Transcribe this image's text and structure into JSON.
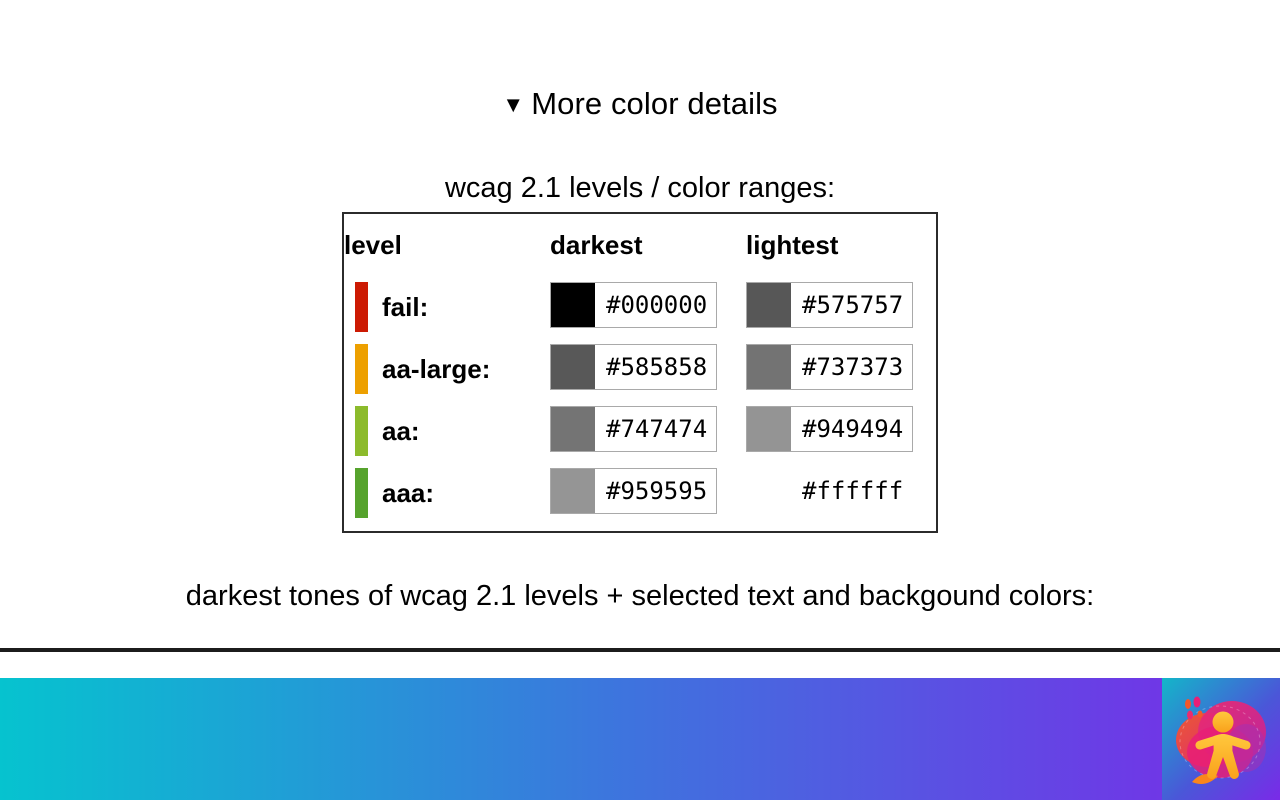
{
  "details": {
    "marker": "▼",
    "summary_label": "More color details"
  },
  "table_caption": "wcag 2.1 levels / color ranges:",
  "levels_table": {
    "columns": [
      "level",
      "darkest",
      "lightest"
    ],
    "rows": [
      {
        "level": "fail:",
        "chip_color": "#cc1a03",
        "darkest": "#000000",
        "lightest": "#575757",
        "lightest_has_border": true
      },
      {
        "level": "aa-large:",
        "chip_color": "#eda000",
        "darkest": "#585858",
        "lightest": "#737373",
        "lightest_has_border": true
      },
      {
        "level": "aa:",
        "chip_color": "#8cbb2c",
        "darkest": "#747474",
        "lightest": "#949494",
        "lightest_has_border": true
      },
      {
        "level": "aaa:",
        "chip_color": "#56a32d",
        "darkest": "#959595",
        "lightest": "#ffffff",
        "lightest_has_border": false
      }
    ]
  },
  "bottom_caption": "darkest tones of wcag 2.1 levels + selected text and backgound colors:",
  "footer": {
    "gradient": {
      "from": "#06c3cf",
      "mid": "#3f72de",
      "to": "#7a2ae8"
    },
    "logo": {
      "name": "accessibility-logo",
      "figure_color": "#fbb034",
      "blob_pink": "#ec1croma",
      "blob_magenta": "#e81f76",
      "blob_orange": "#f4572a"
    }
  }
}
